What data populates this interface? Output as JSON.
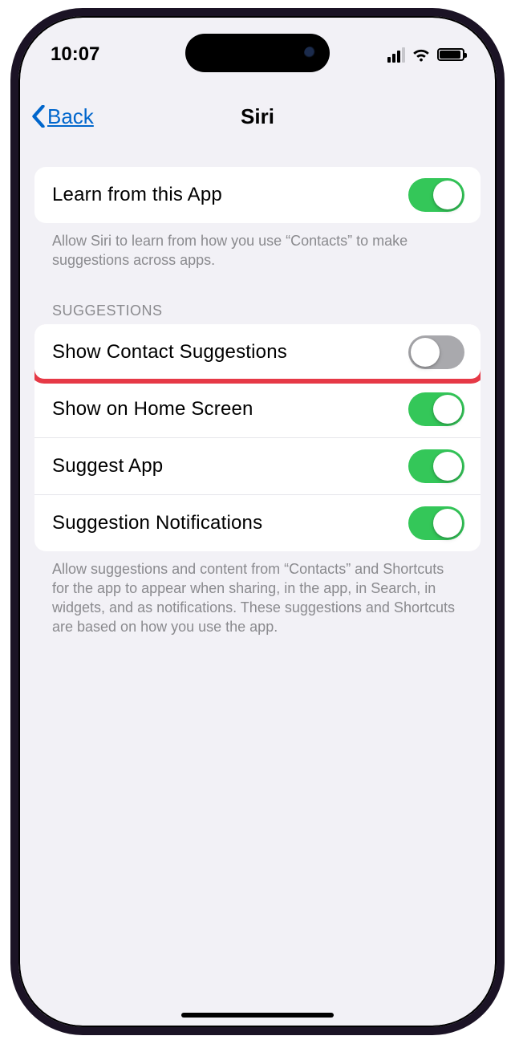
{
  "status": {
    "time": "10:07"
  },
  "nav": {
    "back_label": "Back",
    "title": "Siri"
  },
  "group1": {
    "row1": {
      "label": "Learn from this App",
      "on": true
    },
    "footer": "Allow Siri to learn from how you use “Contacts” to make suggestions across apps."
  },
  "suggestions": {
    "header": "SUGGESTIONS",
    "rows": [
      {
        "label": "Show Contact Suggestions",
        "on": false,
        "highlight": true
      },
      {
        "label": "Show on Home Screen",
        "on": true
      },
      {
        "label": "Suggest App",
        "on": true
      },
      {
        "label": "Suggestion Notifications",
        "on": true
      }
    ],
    "footer": "Allow suggestions and content from “Contacts” and Shortcuts for the app to appear when sharing, in the app, in Search, in widgets, and as notifications. These suggestions and Shortcuts are based on how you use the app."
  }
}
